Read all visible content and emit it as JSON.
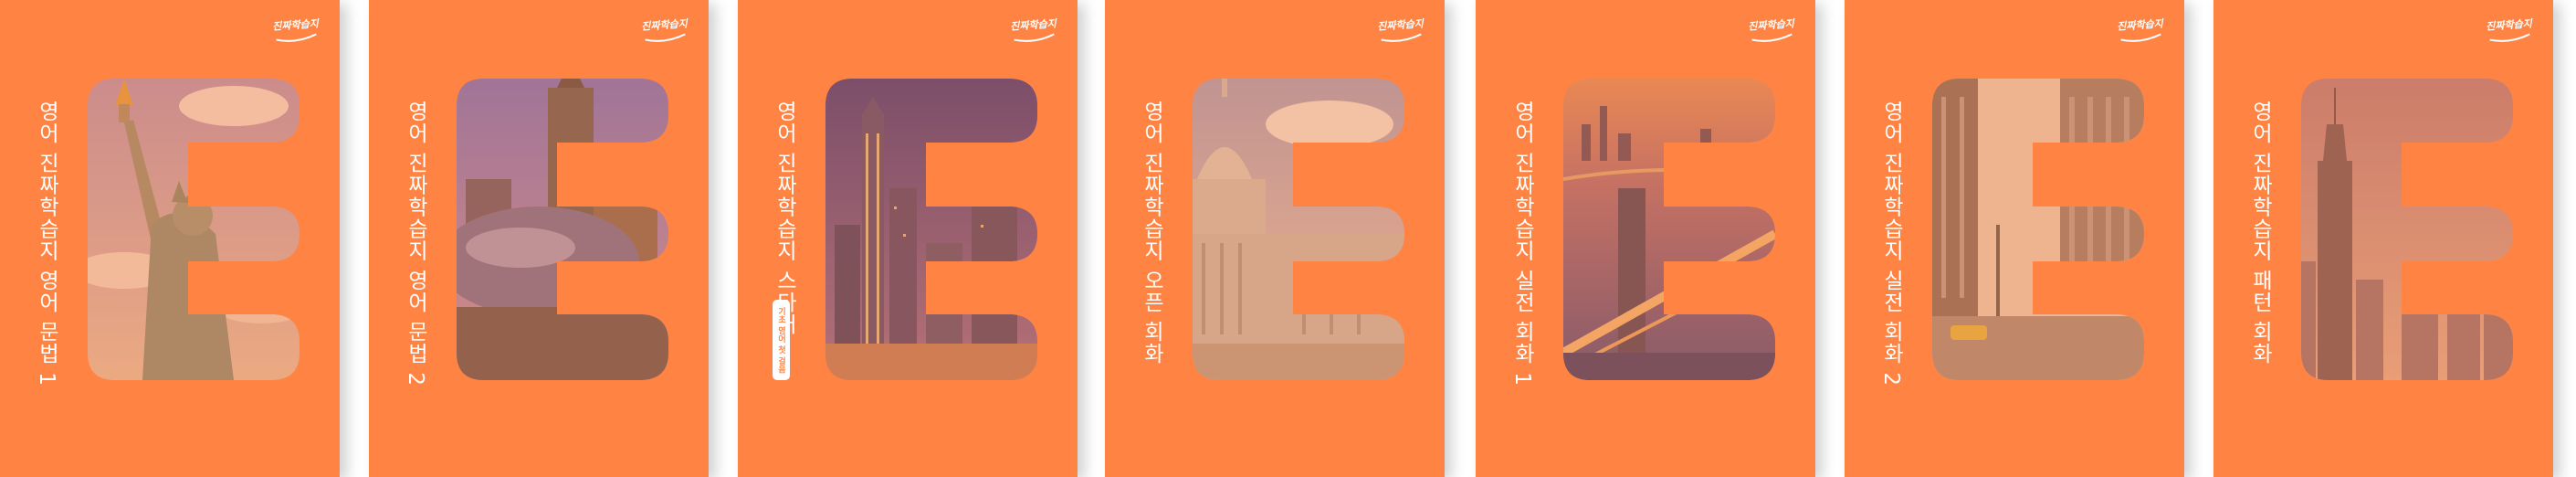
{
  "publisher": {
    "logo_text": "진짜학습지"
  },
  "theme": {
    "cover": "#ff8443",
    "tint": "#ff9a5e",
    "text": "#ffffff"
  },
  "books": [
    {
      "title": "영어 진짜학습지 영어 문법 1",
      "badge": "",
      "photo": "statue-of-liberty"
    },
    {
      "title": "영어 진짜학습지 영어 문법 2",
      "badge": "",
      "photo": "chicago-cloud-gate"
    },
    {
      "title": "영어 진짜학습지 스타터",
      "badge": "기초 영어 첫 걸음",
      "photo": "lower-manhattan-night"
    },
    {
      "title": "영어 진짜학습지 오픈 회화",
      "badge": "",
      "photo": "us-capitol"
    },
    {
      "title": "영어 진짜학습지 실전 회화 1",
      "badge": "",
      "photo": "manhattan-bridge"
    },
    {
      "title": "영어 진짜학습지 실전 회화 2",
      "badge": "",
      "photo": "flatiron-street"
    },
    {
      "title": "영어 진짜학습지 패턴 회화",
      "badge": "",
      "photo": "empire-state-building"
    }
  ]
}
